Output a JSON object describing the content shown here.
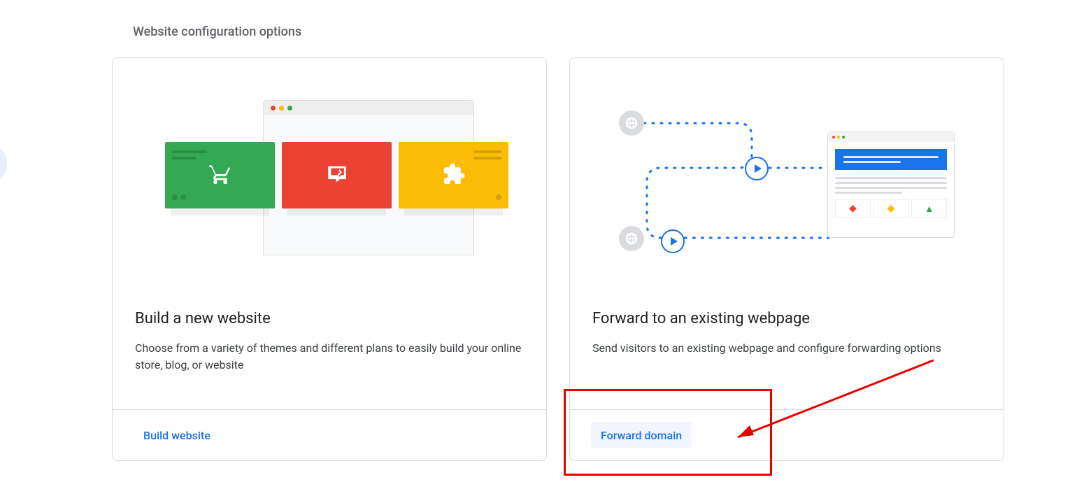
{
  "section_title": "Website configuration options",
  "cards": {
    "build": {
      "title": "Build a new website",
      "desc": "Choose from a variety of themes and different plans to easily build your online store, blog, or website",
      "action": "Build website"
    },
    "forward": {
      "title": "Forward to an existing webpage",
      "desc": "Send visitors to an existing webpage and configure forwarding options",
      "action": "Forward domain"
    }
  }
}
